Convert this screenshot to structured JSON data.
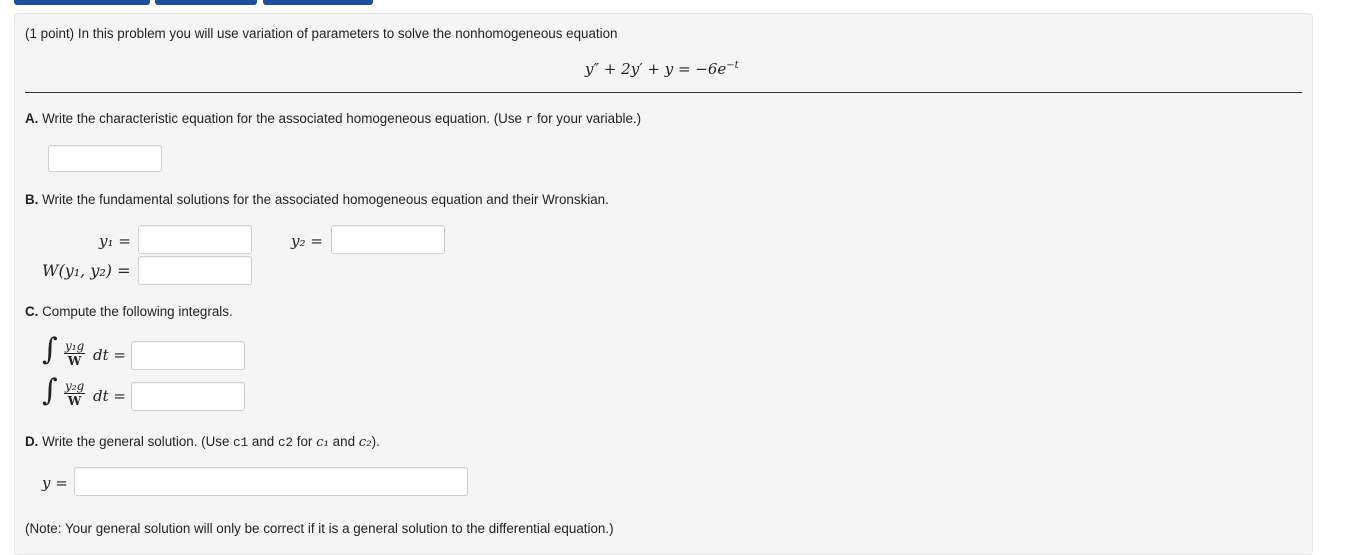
{
  "problem": {
    "intro": "(1 point) In this problem you will use variation of parameters to solve the nonhomogeneous equation",
    "equation": "y″ + 2y′ + y = −6e",
    "equation_exp": "−t"
  },
  "partA": {
    "label": "A.",
    "text_before": " Write the characteristic equation for the associated homogeneous equation. (Use ",
    "var": "r",
    "text_after": " for your variable.)",
    "input_value": ""
  },
  "partB": {
    "label": "B.",
    "text": " Write the fundamental solutions for the associated homogeneous equation and their Wronskian.",
    "y1_label": "y₁ =",
    "y2_label": "y₂ =",
    "w_label": "W(y₁, y₂) =",
    "y1_value": "",
    "y2_value": "",
    "w_value": ""
  },
  "partC": {
    "label": "C.",
    "text": " Compute the following integrals.",
    "int1_num": "y₁g",
    "int2_num": "y₂g",
    "den": "W",
    "dt": "dt =",
    "int_symbol": "∫",
    "int1_value": "",
    "int2_value": ""
  },
  "partD": {
    "label": "D.",
    "text1": " Write the general solution. (Use ",
    "c1": "c1",
    "text2": " and ",
    "c2": "c2",
    "text3": " for ",
    "c1m": "c₁",
    "text4": " and ",
    "c2m": "c₂",
    "text5": ").",
    "y_label": "y =",
    "y_value": ""
  },
  "note": "(Note: Your general solution will only be correct if it is a general solution to the differential equation.)"
}
